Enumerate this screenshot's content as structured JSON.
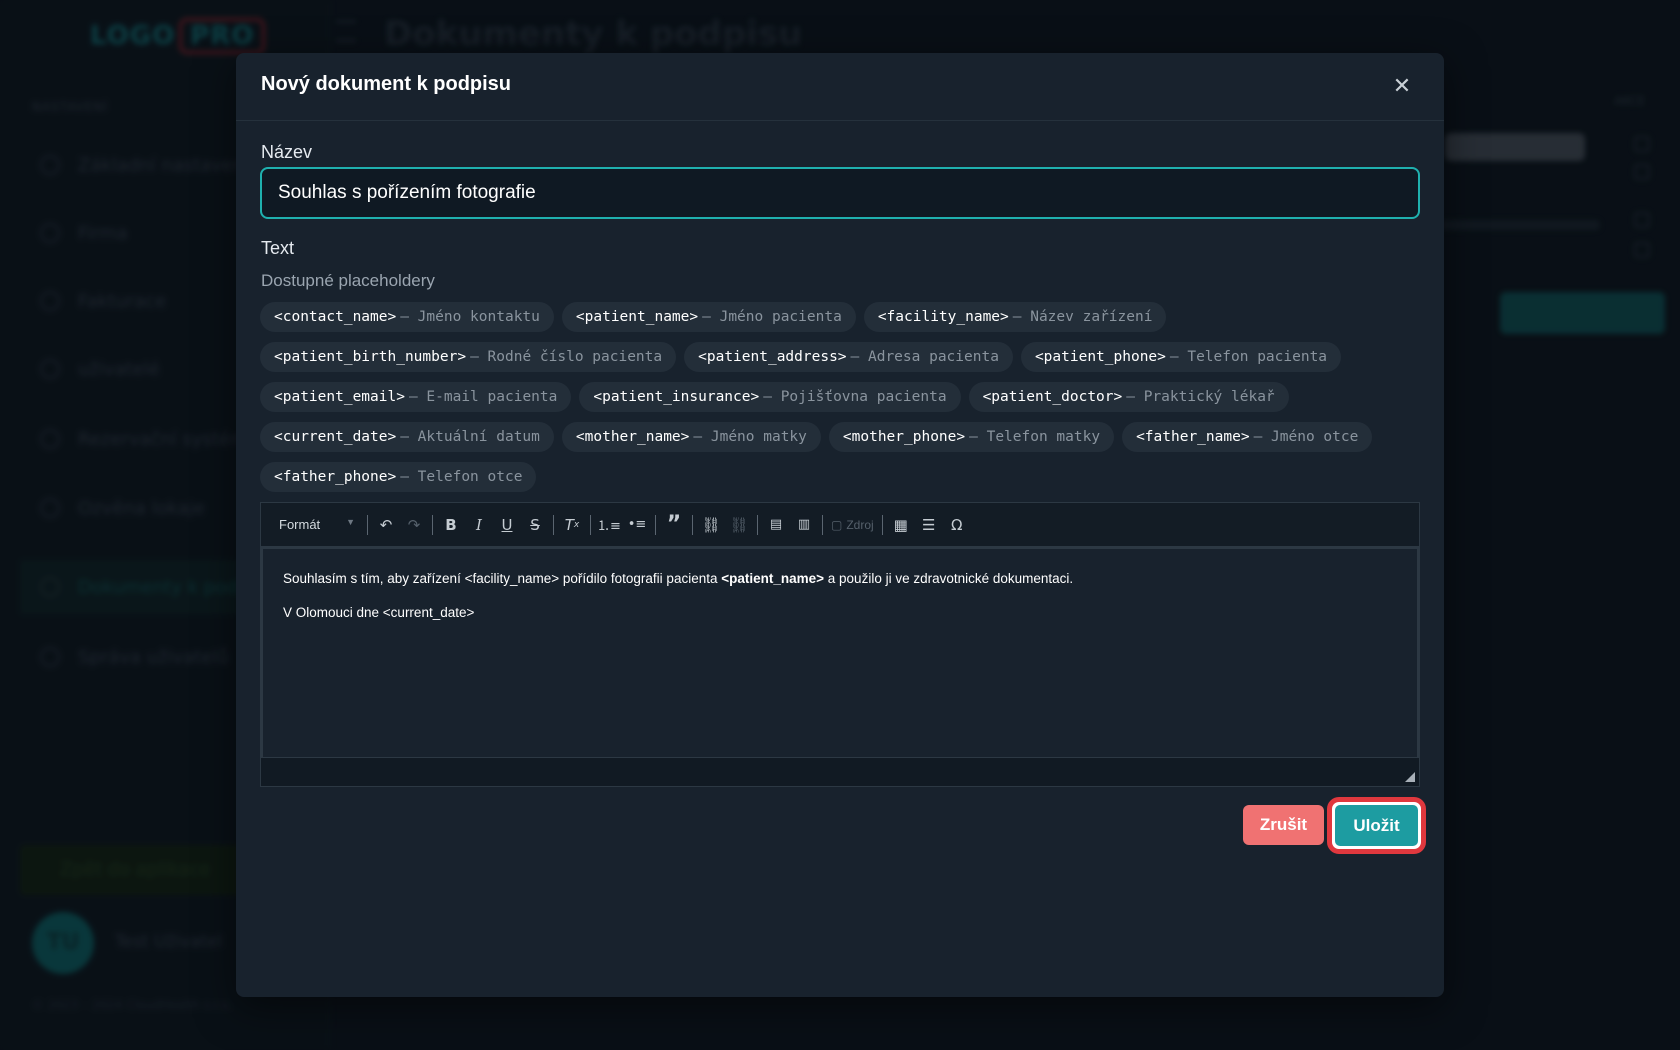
{
  "background": {
    "logo": "LOGO",
    "logo_badge": "PRO",
    "section_label": "NASTAVENÍ",
    "page_title": "Dokumenty k podpisu",
    "nav_items": [
      {
        "label": "Základní nastavení"
      },
      {
        "label": "Firma"
      },
      {
        "label": "Fakturace"
      },
      {
        "label": "uživatelé"
      },
      {
        "label": "Rezervační systém"
      },
      {
        "label": "Ozvěna lokaje"
      },
      {
        "label": "Dokumenty k podpisu"
      },
      {
        "label": "Správa uživatelů"
      }
    ],
    "cta_label": "Zpět do aplikace",
    "user_initials": "TU",
    "user_name": "Test Uživatel",
    "footer": "© 2023 – 2024 CloudHealth s.r.o.",
    "column_header": "AKCE",
    "row_text": "Souhlas s fotografií",
    "new_button": "Nový dokument"
  },
  "modal": {
    "title": "Nový dokument k podpisu",
    "close_icon": "close-icon",
    "name_label": "Název",
    "name_value": "Souhlas s pořízením fotografie",
    "text_label": "Text",
    "placeholders_heading": "Dostupné placeholdery",
    "placeholders": [
      {
        "key": "<contact_name>",
        "desc": "— Jméno kontaktu"
      },
      {
        "key": "<patient_name>",
        "desc": "— Jméno pacienta"
      },
      {
        "key": "<facility_name>",
        "desc": "— Název zařízení"
      },
      {
        "key": "<patient_birth_number>",
        "desc": "— Rodné číslo pacienta"
      },
      {
        "key": "<patient_address>",
        "desc": "— Adresa pacienta"
      },
      {
        "key": "<patient_phone>",
        "desc": "— Telefon pacienta"
      },
      {
        "key": "<patient_email>",
        "desc": "— E-mail pacienta"
      },
      {
        "key": "<patient_insurance>",
        "desc": "— Pojišťovna pacienta"
      },
      {
        "key": "<patient_doctor>",
        "desc": "— Praktický lékař"
      },
      {
        "key": "<current_date>",
        "desc": "— Aktuální datum"
      },
      {
        "key": "<mother_name>",
        "desc": "— Jméno matky"
      },
      {
        "key": "<mother_phone>",
        "desc": "— Telefon matky"
      },
      {
        "key": "<father_name>",
        "desc": "— Jméno otce"
      },
      {
        "key": "<father_phone>",
        "desc": "— Telefon otce"
      }
    ],
    "editor": {
      "format_label": "Formát",
      "source_label": "Zdroj",
      "toolbar_icons": [
        "undo-icon",
        "redo-icon",
        "bold-icon",
        "italic-icon",
        "underline-icon",
        "strikethrough-icon",
        "remove-format-icon",
        "numbered-list-icon",
        "bulleted-list-icon",
        "blockquote-icon",
        "link-icon",
        "unlink-icon",
        "paste-text-icon",
        "paste-word-icon",
        "source-icon",
        "table-icon",
        "horizontal-line-icon",
        "special-char-icon"
      ],
      "para1_before": "Souhlasím s tím, aby zařízení <facility_name> pořídilo fotografii pacienta ",
      "para1_bold": "<patient_name>",
      "para1_after": " a použilo ji ve zdravotnické dokumentaci.",
      "para2": "V Olomouci dne <current_date>"
    },
    "cancel_label": "Zrušit",
    "save_label": "Uložit"
  },
  "colors": {
    "accent": "#1fb0ae",
    "save_button": "#1d9ca1",
    "cancel_button": "#f07272",
    "highlight_ring": "#e0383e",
    "modal_bg": "#18222d"
  }
}
